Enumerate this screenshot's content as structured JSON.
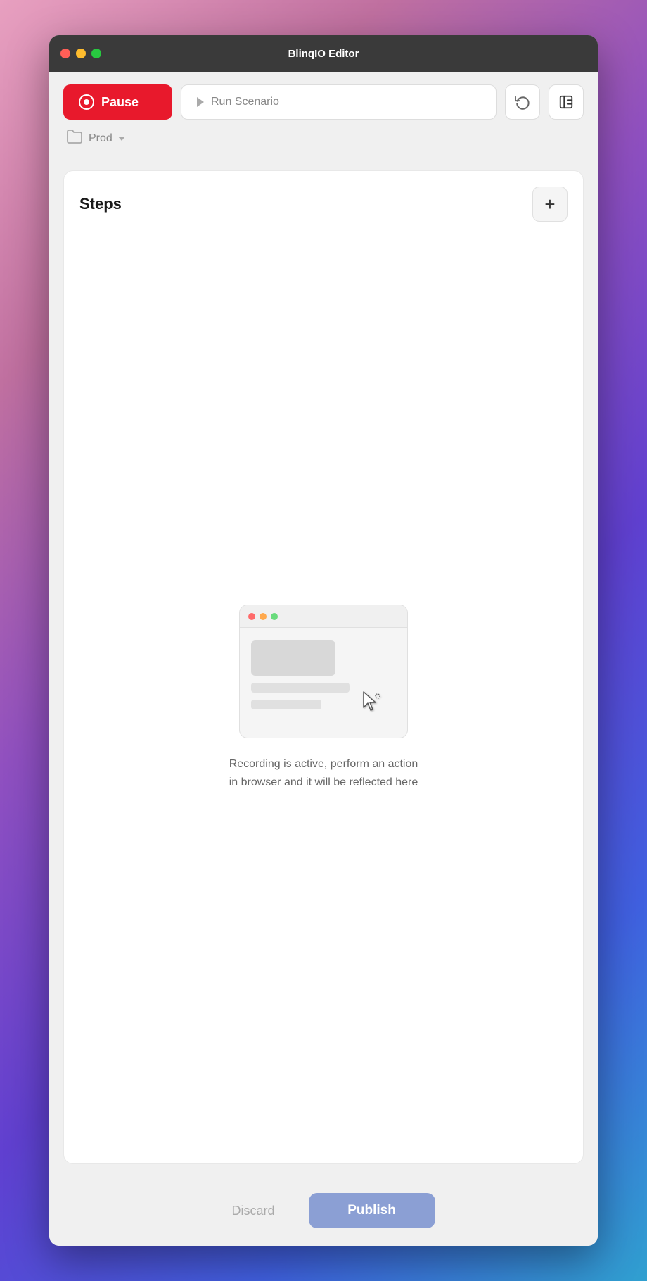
{
  "window": {
    "title": "BlinqIO Editor"
  },
  "toolbar": {
    "pause_label": "Pause",
    "run_scenario_label": "Run Scenario",
    "env_label": "Prod"
  },
  "steps": {
    "title": "Steps",
    "add_button_label": "+",
    "recording_message_line1": "Recording is active, perform an action",
    "recording_message_line2": "in browser and it will be reflected here"
  },
  "footer": {
    "discard_label": "Discard",
    "publish_label": "Publish"
  },
  "colors": {
    "pause_bg": "#e8192c",
    "publish_bg": "#8b9fd4"
  }
}
